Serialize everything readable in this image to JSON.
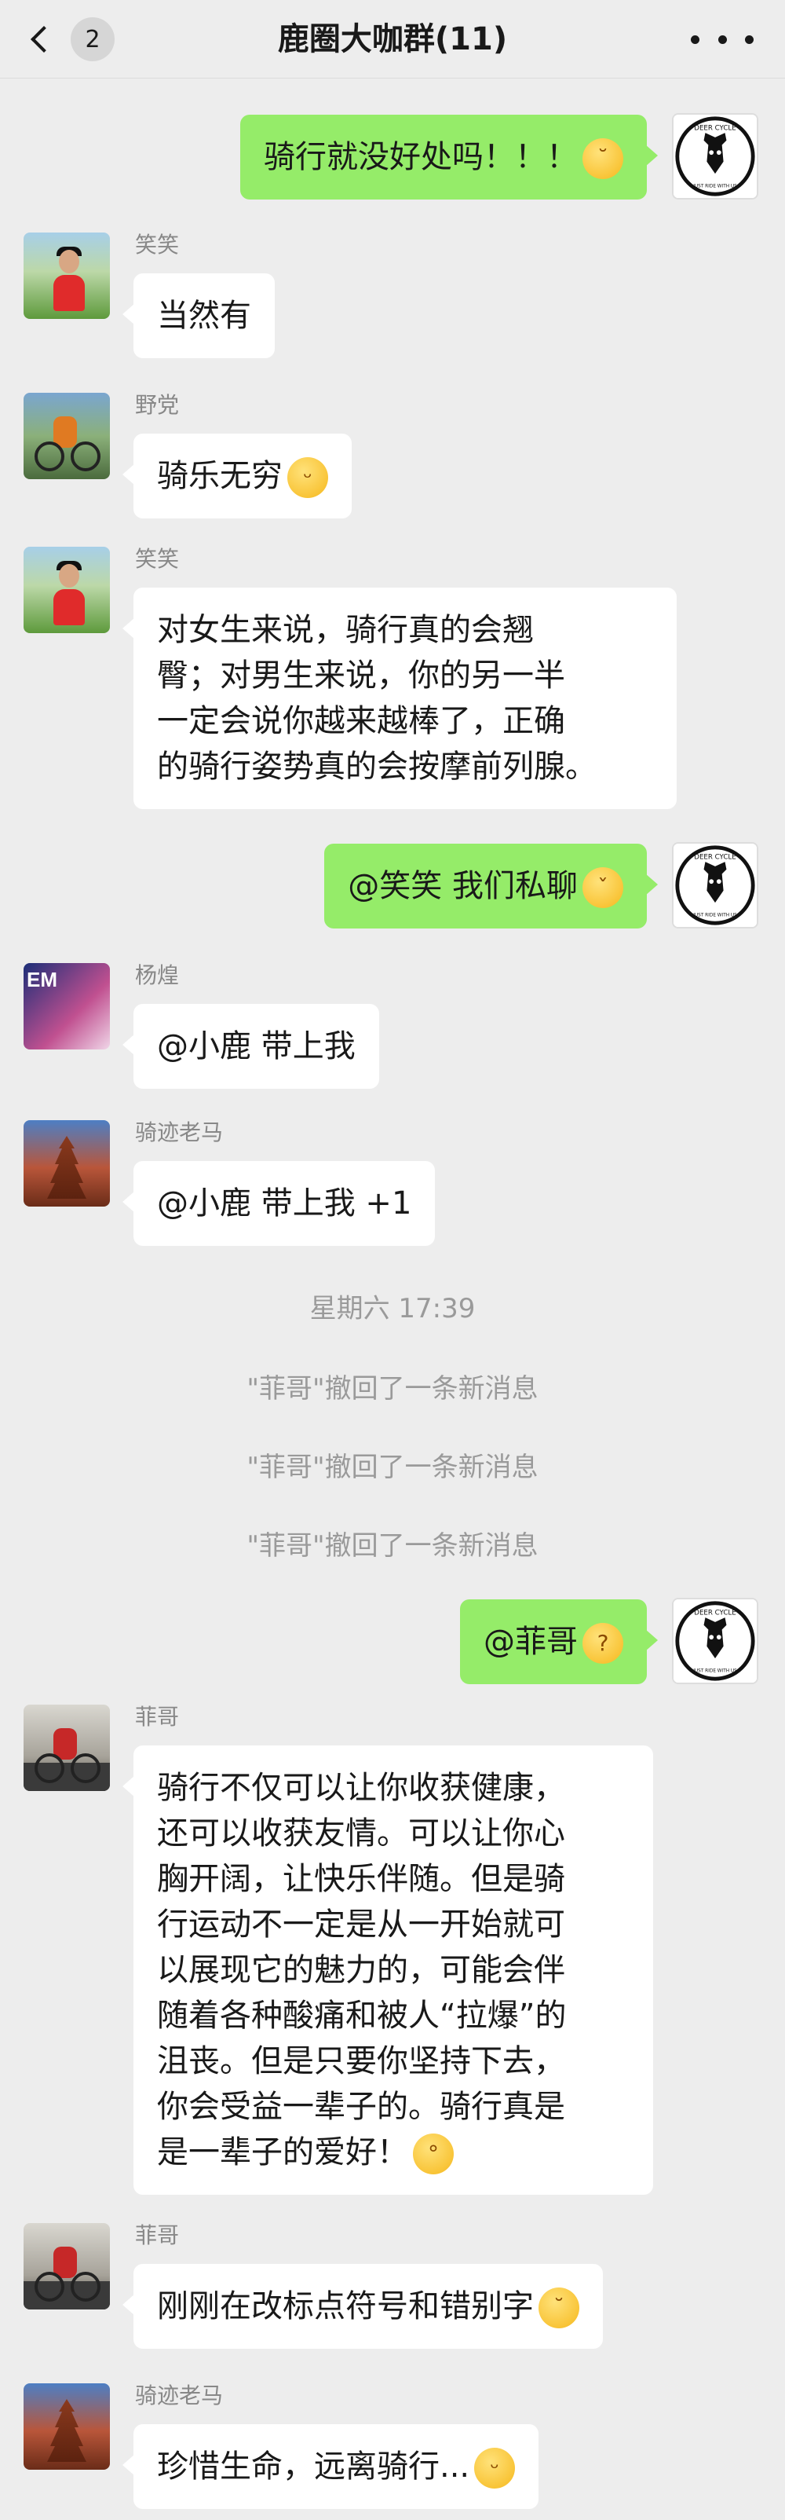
{
  "nav": {
    "unread_count": "2",
    "title": "鹿圈大咖群(11)"
  },
  "me_avatar": {
    "lines": [
      "DEER CYCLE",
      "JUST RIDE WITH US"
    ]
  },
  "messages": [
    {
      "from": "me",
      "text": "骑行就没好处吗！！！",
      "emoji": "face-with-relieved-icon"
    },
    {
      "from": "笑笑",
      "text": "当然有"
    },
    {
      "from": "野党",
      "text": "骑乐无穷",
      "emoji": "grinning-face-icon"
    },
    {
      "from": "笑笑",
      "lines": [
        "对女生来说，骑行真的会翘",
        "臀；对男生来说，你的另一半",
        "一定会说你越来越棒了，正确",
        "的骑行姿势真的会按摩前列腺。"
      ]
    },
    {
      "from": "me",
      "text": "@笑笑 我们私聊",
      "emoji": "shushing-face-icon"
    },
    {
      "from": "杨煌",
      "text": "@小鹿 带上我"
    },
    {
      "from": "骑迹老马",
      "text": "@小鹿 带上我 +1"
    },
    {
      "from": "me",
      "text": "@菲哥",
      "emoji": "thinking-face-icon"
    },
    {
      "from": "菲哥",
      "lines": [
        "骑行不仅可以让你收获健康，",
        "还可以收获友情。可以让你心",
        "胸开阔，让快乐伴随。但是骑",
        "行运动不一定是从一开始就可",
        "以展现它的魅力的，可能会伴",
        "随着各种酸痛和被人“拉爆”的",
        "沮丧。但是只要你坚持下去，",
        "你会受益一辈子的。骑行真是",
        "是一辈子的爱好！"
      ],
      "emoji": "monocle-face-icon"
    },
    {
      "from": "菲哥",
      "text": "刚刚在改标点符号和错别字",
      "emoji": "face-with-relieved-icon"
    },
    {
      "from": "骑迹老马",
      "text": "珍惜生命，远离骑行...",
      "emoji": "smiling-face-icon"
    }
  ],
  "system": {
    "time": "星期六 17:39",
    "recall": "\"菲哥\"撤回了一条新消息"
  },
  "colors": {
    "background": "#ededed",
    "bubble_out": "#95ec69",
    "bubble_in": "#ffffff"
  }
}
